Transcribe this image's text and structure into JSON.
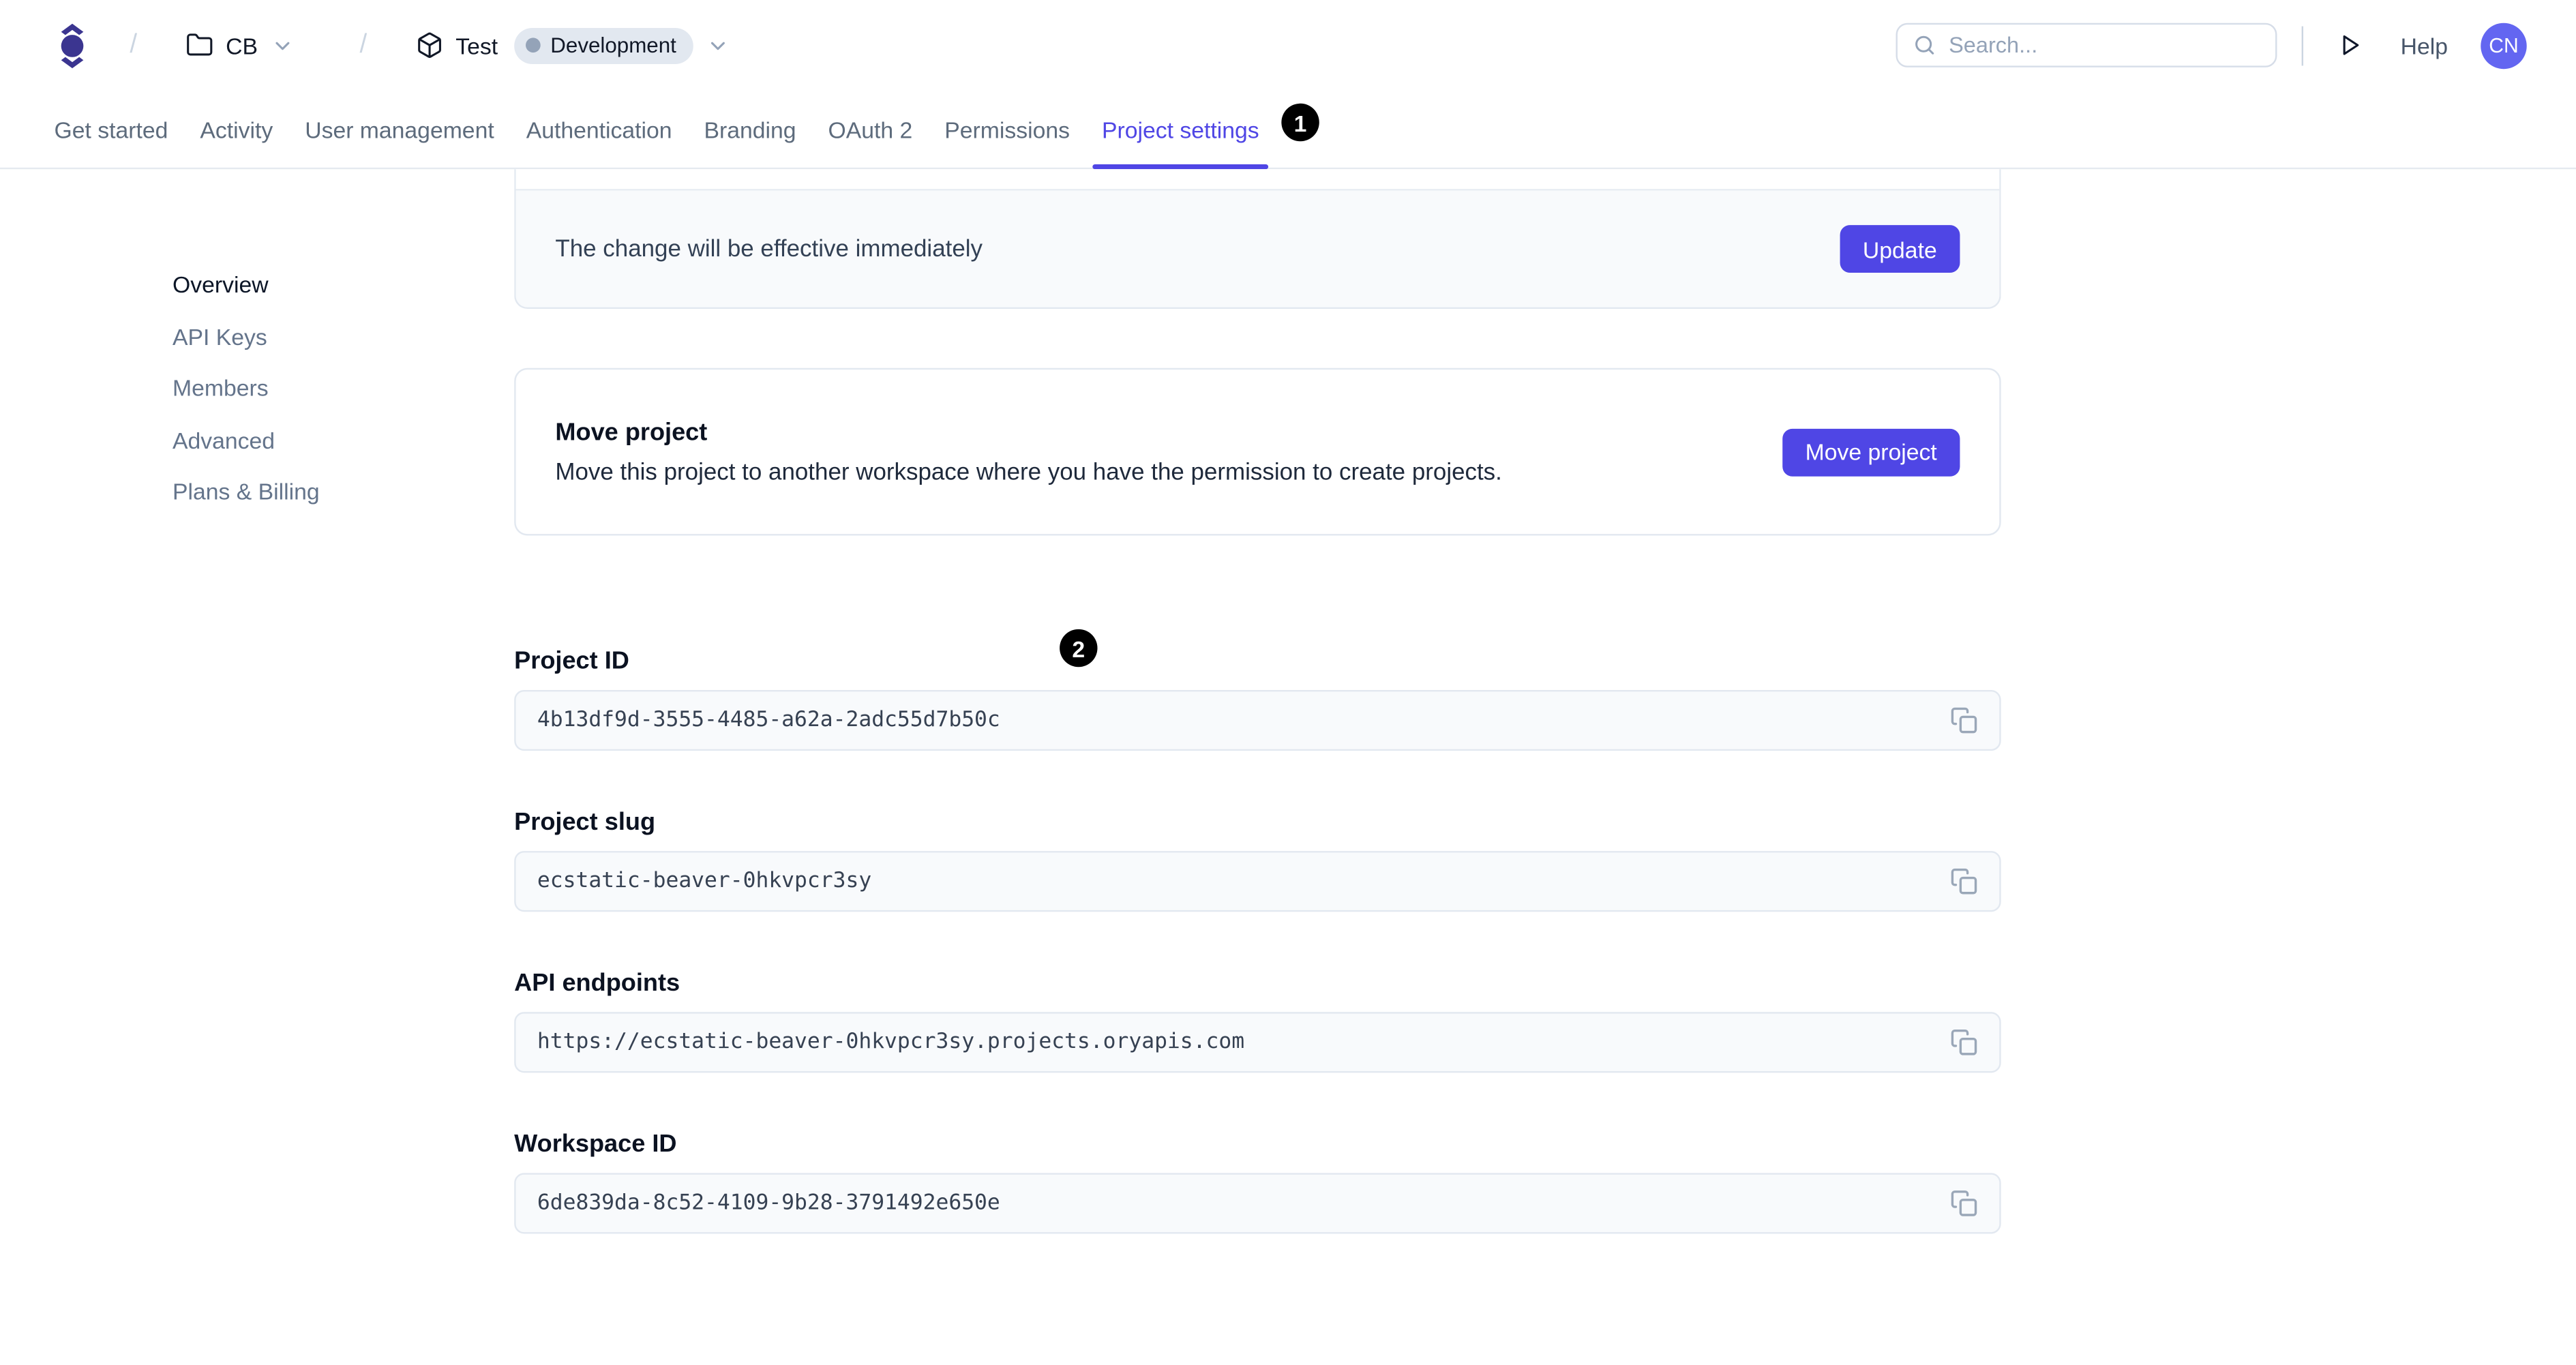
{
  "header": {
    "breadcrumb": {
      "separator": "/",
      "workspace_label": "CB",
      "project_label": "Test",
      "environment_badge": "Development"
    },
    "search": {
      "placeholder": "Search..."
    },
    "help_label": "Help",
    "avatar_initials": "CN"
  },
  "tabs": {
    "items": [
      "Get started",
      "Activity",
      "User management",
      "Authentication",
      "Branding",
      "OAuth 2",
      "Permissions",
      "Project settings"
    ],
    "active": "Project settings"
  },
  "annotations": {
    "badge_1": "1",
    "badge_2": "2"
  },
  "sidebar": {
    "items": [
      "Overview",
      "API Keys",
      "Members",
      "Advanced",
      "Plans & Billing"
    ],
    "active": "Overview"
  },
  "main": {
    "update_card": {
      "message": "The change will be effective immediately",
      "button_label": "Update"
    },
    "move_card": {
      "title": "Move project",
      "description": "Move this project to another workspace where you have the permission to create projects.",
      "button_label": "Move project"
    },
    "fields": [
      {
        "label": "Project ID",
        "value": "4b13df9d-3555-4485-a62a-2adc55d7b50c"
      },
      {
        "label": "Project slug",
        "value": "ecstatic-beaver-0hkvpcr3sy"
      },
      {
        "label": "API endpoints",
        "value": "https://ecstatic-beaver-0hkvpcr3sy.projects.oryapis.com"
      },
      {
        "label": "Workspace ID",
        "value": "6de839da-8c52-4109-9b28-3791492e650e"
      }
    ]
  },
  "colors": {
    "accent": "#4f46e5",
    "logo": "#3b3590",
    "avatar_bg": "#6366f1",
    "annotation_badge_bg": "#000000",
    "field_bg": "#f8fafc",
    "border": "#e2e8f0",
    "env_badge_bg": "#e2e8f0",
    "env_dot": "#94a3b8"
  }
}
